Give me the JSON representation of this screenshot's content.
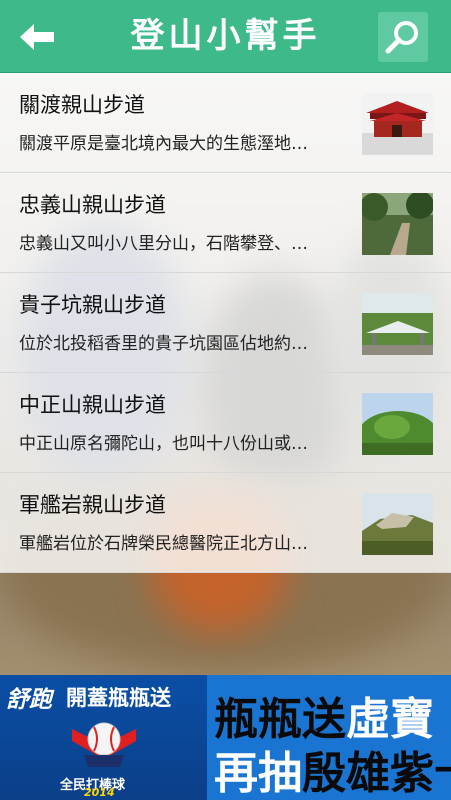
{
  "header": {
    "title": "登山小幫手",
    "back_icon": "back-arrow-icon",
    "search_icon": "search-icon",
    "color": "#3db98a"
  },
  "trails": [
    {
      "name": "關渡親山步道",
      "description": "關渡平原是臺北境內最大的生態溼地…",
      "thumb": "temple-photo"
    },
    {
      "name": "忠義山親山步道",
      "description": "忠義山又叫小八里分山，石階攀登、…",
      "thumb": "forest-path-photo"
    },
    {
      "name": "貴子坑親山步道",
      "description": "位於北投稻香里的貴子坑園區佔地約…",
      "thumb": "pavilion-photo"
    },
    {
      "name": "中正山親山步道",
      "description": "中正山原名彌陀山，也叫十八份山或…",
      "thumb": "green-hill-photo"
    },
    {
      "name": "軍艦岩親山步道",
      "description": "軍艦岩位於石牌榮民總醫院正北方山…",
      "thumb": "rock-photo"
    }
  ],
  "ad": {
    "brand": "舒跑",
    "subtitle": "開蓋瓶瓶送",
    "logo_text": "全民打棒球",
    "logo_year": "2014",
    "line1_a": "瓶瓶送",
    "line1_b": "虛寶",
    "line2_a": "再抽",
    "line2_b": "殷雄紫卡"
  }
}
